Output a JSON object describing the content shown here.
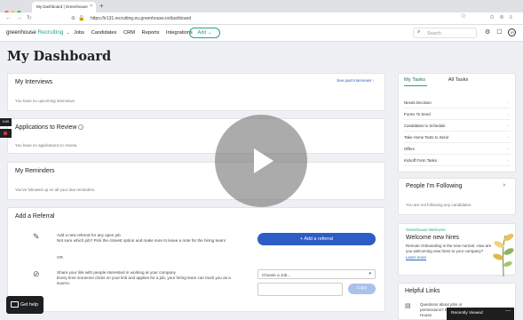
{
  "browser": {
    "tab_title": "My Dashboard | Greenhouse",
    "tab_close": "×",
    "new_tab": "+",
    "url": "https://ir131.recruiting.eu.greenhouse.io/dashboard",
    "nav_glyphs": "←→↻",
    "url_icons": "⊕🔒",
    "star": "☆",
    "extensions": "⊙⊚≡"
  },
  "appbar": {
    "logo_prefix": "greenhouse",
    "logo_suffix": "Recruiting",
    "logo_chevron": "⌄",
    "nav": [
      "Jobs",
      "Candidates",
      "CRM",
      "Reports",
      "Integrations"
    ],
    "add_label": "Add ⌄",
    "search_placeholder": "Search",
    "search_icon": "⌕",
    "settings_icon": "⚙",
    "notifications_icon": "☐",
    "avatar_initials": "IR"
  },
  "page": {
    "title": "My Dashboard"
  },
  "interviews": {
    "title": "My Interviews",
    "past_link": "See past interviews ›",
    "empty": "You have no upcoming interviews."
  },
  "applications": {
    "title": "Applications to Review",
    "info_icon": "i",
    "empty": "You have no applications to review."
  },
  "reminders": {
    "title": "My Reminders",
    "empty": "You've followed up on all your due reminders."
  },
  "referral": {
    "title": "Add a Referral",
    "row1_line1": "Add a new referral for any open job",
    "row1_line2": "Not sure which job? Pick the closest option and make sure to leave a note for the hiring team!",
    "or": "OR",
    "row2_line1": "Share your link with people interested in working at your company",
    "row2_line2": "Every time someone clicks on your link and applies for a job, your hiring team can track you as a",
    "row2_line3": "source.",
    "add_button": "+ Add a referral",
    "select_placeholder": "Choose a Job...",
    "select_arrow": "▾",
    "copy_button": "Copy",
    "edit_icon": "✎",
    "ban_icon": "⊘"
  },
  "tasks": {
    "tab_my": "My Tasks",
    "tab_all": "All Tasks",
    "rows": [
      {
        "label": "Needs Decision",
        "value": "-"
      },
      {
        "label": "Forms To Send",
        "value": "-"
      },
      {
        "label": "Candidates to Schedule",
        "value": "-"
      },
      {
        "label": "Take Home Tests to Send",
        "value": "-"
      },
      {
        "label": "Offers",
        "value": "-"
      },
      {
        "label": "Kickoff Form Tasks",
        "value": "-"
      }
    ]
  },
  "following": {
    "title": "People I'm Following",
    "chevron": "›",
    "empty": "You are not following any candidates."
  },
  "welcome": {
    "tag": "Greenhouse Welcome",
    "title": "Welcome new hires",
    "body": "Remote Onboarding is the new normal. How are you welcoming new hires to your company?",
    "link": "Learn more"
  },
  "helpful": {
    "title": "Helpful Links",
    "icon": "▤",
    "item": "Questions about jobs or permissions? Email Your In-House"
  },
  "overlays": {
    "recently_viewed": "Recently Viewed",
    "recently_close": "—",
    "get_help": "Get help",
    "rec_timer": "0:00"
  },
  "colors": {
    "brand_green": "#24a47f",
    "primary_blue": "#2c5cc5",
    "link_blue": "#2f63b5"
  }
}
